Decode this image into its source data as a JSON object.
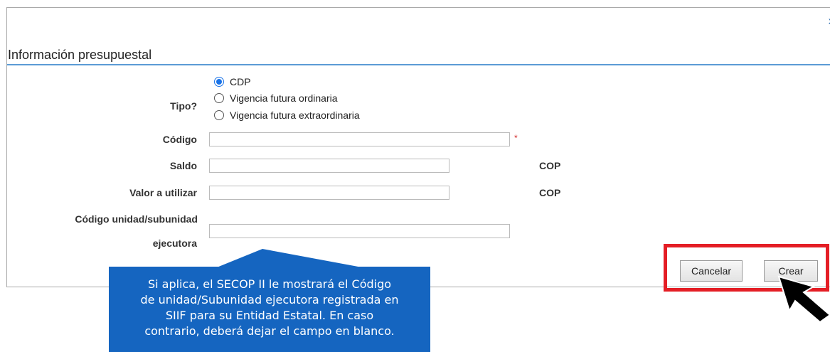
{
  "dialog": {
    "close_glyph": "x",
    "section_title": "Información presupuestal"
  },
  "form": {
    "tipo": {
      "label": "Tipo?",
      "options": [
        {
          "label": "CDP",
          "selected": true
        },
        {
          "label": "Vigencia futura ordinaria",
          "selected": false
        },
        {
          "label": "Vigencia futura extraordinaria",
          "selected": false
        }
      ]
    },
    "codigo": {
      "label": "Código",
      "value": "",
      "required_mark": "*"
    },
    "saldo": {
      "label": "Saldo",
      "value": "",
      "currency": "COP"
    },
    "valor": {
      "label": "Valor a utilizar",
      "value": "",
      "currency": "COP"
    },
    "unidad": {
      "label_line1": "Código unidad/subunidad",
      "label_line2": "ejecutora",
      "value": ""
    }
  },
  "buttons": {
    "cancel_label": "Cancelar",
    "create_label": "Crear"
  },
  "callout": {
    "lines": [
      "Si aplica, el SECOP II le mostrará el Código",
      "de unidad/Subunidad ejecutora registrada en",
      "SIIF para su Entidad Estatal. En caso",
      "contrario, deberá dejar el campo en blanco."
    ]
  },
  "colors": {
    "accent_blue": "#1565c0",
    "highlight_red": "#e41e25",
    "header_line": "#5b9bd5",
    "radio_selected": "#1a73e8"
  },
  "icons": {
    "close": "close-icon",
    "cursor": "mouse-pointer-icon"
  }
}
